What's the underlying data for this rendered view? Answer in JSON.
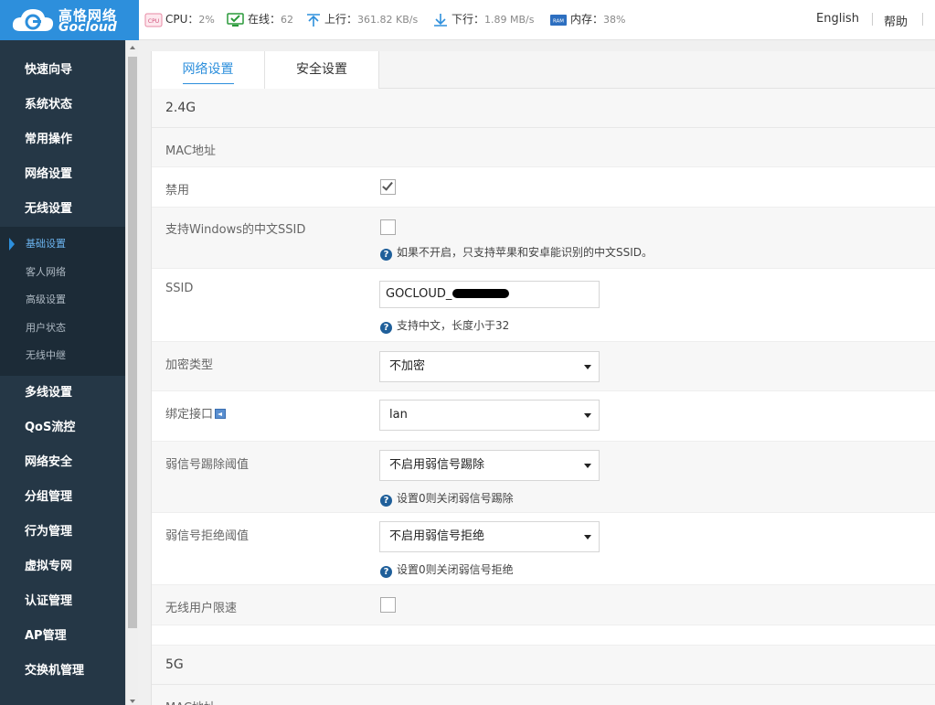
{
  "brand": {
    "name_cn": "高恪网络",
    "name_en": "Gocloud",
    "color": "#2d8fdc"
  },
  "stats": {
    "cpu_label": "CPU：",
    "cpu_value": "2%",
    "online_label": "在线：",
    "online_value": "62",
    "up_label": "上行：",
    "up_value": "361.82 KB/s",
    "down_label": "下行：",
    "down_value": "1.89 MB/s",
    "mem_label": "内存：",
    "mem_value": "38%",
    "cpu_icon_text": "CPU",
    "ram_icon_text": "RAM"
  },
  "top_links": {
    "language": "English",
    "help": "帮助"
  },
  "sidebar": {
    "items_top": [
      "快速向导",
      "系统状态",
      "常用操作",
      "网络设置",
      "无线设置"
    ],
    "sub_items": [
      "基础设置",
      "客人网络",
      "高级设置",
      "用户状态",
      "无线中继"
    ],
    "active_sub": "基础设置",
    "items_bottom": [
      "多线设置",
      "QoS流控",
      "网络安全",
      "分组管理",
      "行为管理",
      "虚拟专网",
      "认证管理",
      "AP管理",
      "交换机管理"
    ]
  },
  "tabs": {
    "network": "网络设置",
    "security": "安全设置"
  },
  "section_24g": {
    "title": "2.4G",
    "mac_label": "MAC地址",
    "disable_label": "禁用",
    "disable_checked": true,
    "win_ssid_label": "支持Windows的中文SSID",
    "win_ssid_hint": "如果不开启，只支持苹果和安卓能识别的中文SSID。",
    "ssid_label": "SSID",
    "ssid_value": "GOCLOUD_",
    "ssid_hint": "支持中文，长度小于32",
    "encrypt_label": "加密类型",
    "encrypt_value": "不加密",
    "bind_label": "绑定接口",
    "bind_value": "lan",
    "kick_label": "弱信号踢除阈值",
    "kick_value": "不启用弱信号踢除",
    "kick_hint": "设置0则关闭弱信号踢除",
    "reject_label": "弱信号拒绝阈值",
    "reject_value": "不启用弱信号拒绝",
    "reject_hint": "设置0则关闭弱信号拒绝",
    "limit_label": "无线用户限速"
  },
  "section_5g": {
    "title": "5G",
    "mac_label": "MAC地址"
  }
}
